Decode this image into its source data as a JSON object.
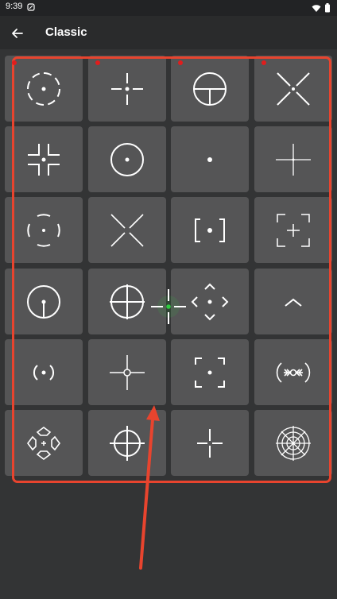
{
  "status_bar": {
    "time": "9:39"
  },
  "app_bar": {
    "title": "Classic"
  },
  "crosshairs": [
    "circle-gap-dot-icon",
    "crosshair-gap-dot-icon",
    "circle-cross-top-icon",
    "x-diagonal-icon",
    "bracket-corners-dot-icon",
    "circle-dot-icon",
    "center-dot-icon",
    "thin-cross-icon",
    "dashed-circle-dot-icon",
    "x-gap-icon",
    "square-brackets-dot-icon",
    "corner-frame-cross-icon",
    "circle-stem-dot-icon",
    "circle-cross-large-icon",
    "diamond-dot-icon",
    "chevron-up-icon",
    "parentheses-dot-icon",
    "cross-ring-center-icon",
    "corner-frame-dot-icon",
    "arrow-ring-icon",
    "diamond-petals-icon",
    "circle-cross-scope-icon",
    "cross-small-gap-icon",
    "radar-scope-icon"
  ],
  "colors": {
    "accent": "#e8442e",
    "marker": "#e01d1d",
    "floating_dot": "#2ecc40"
  }
}
